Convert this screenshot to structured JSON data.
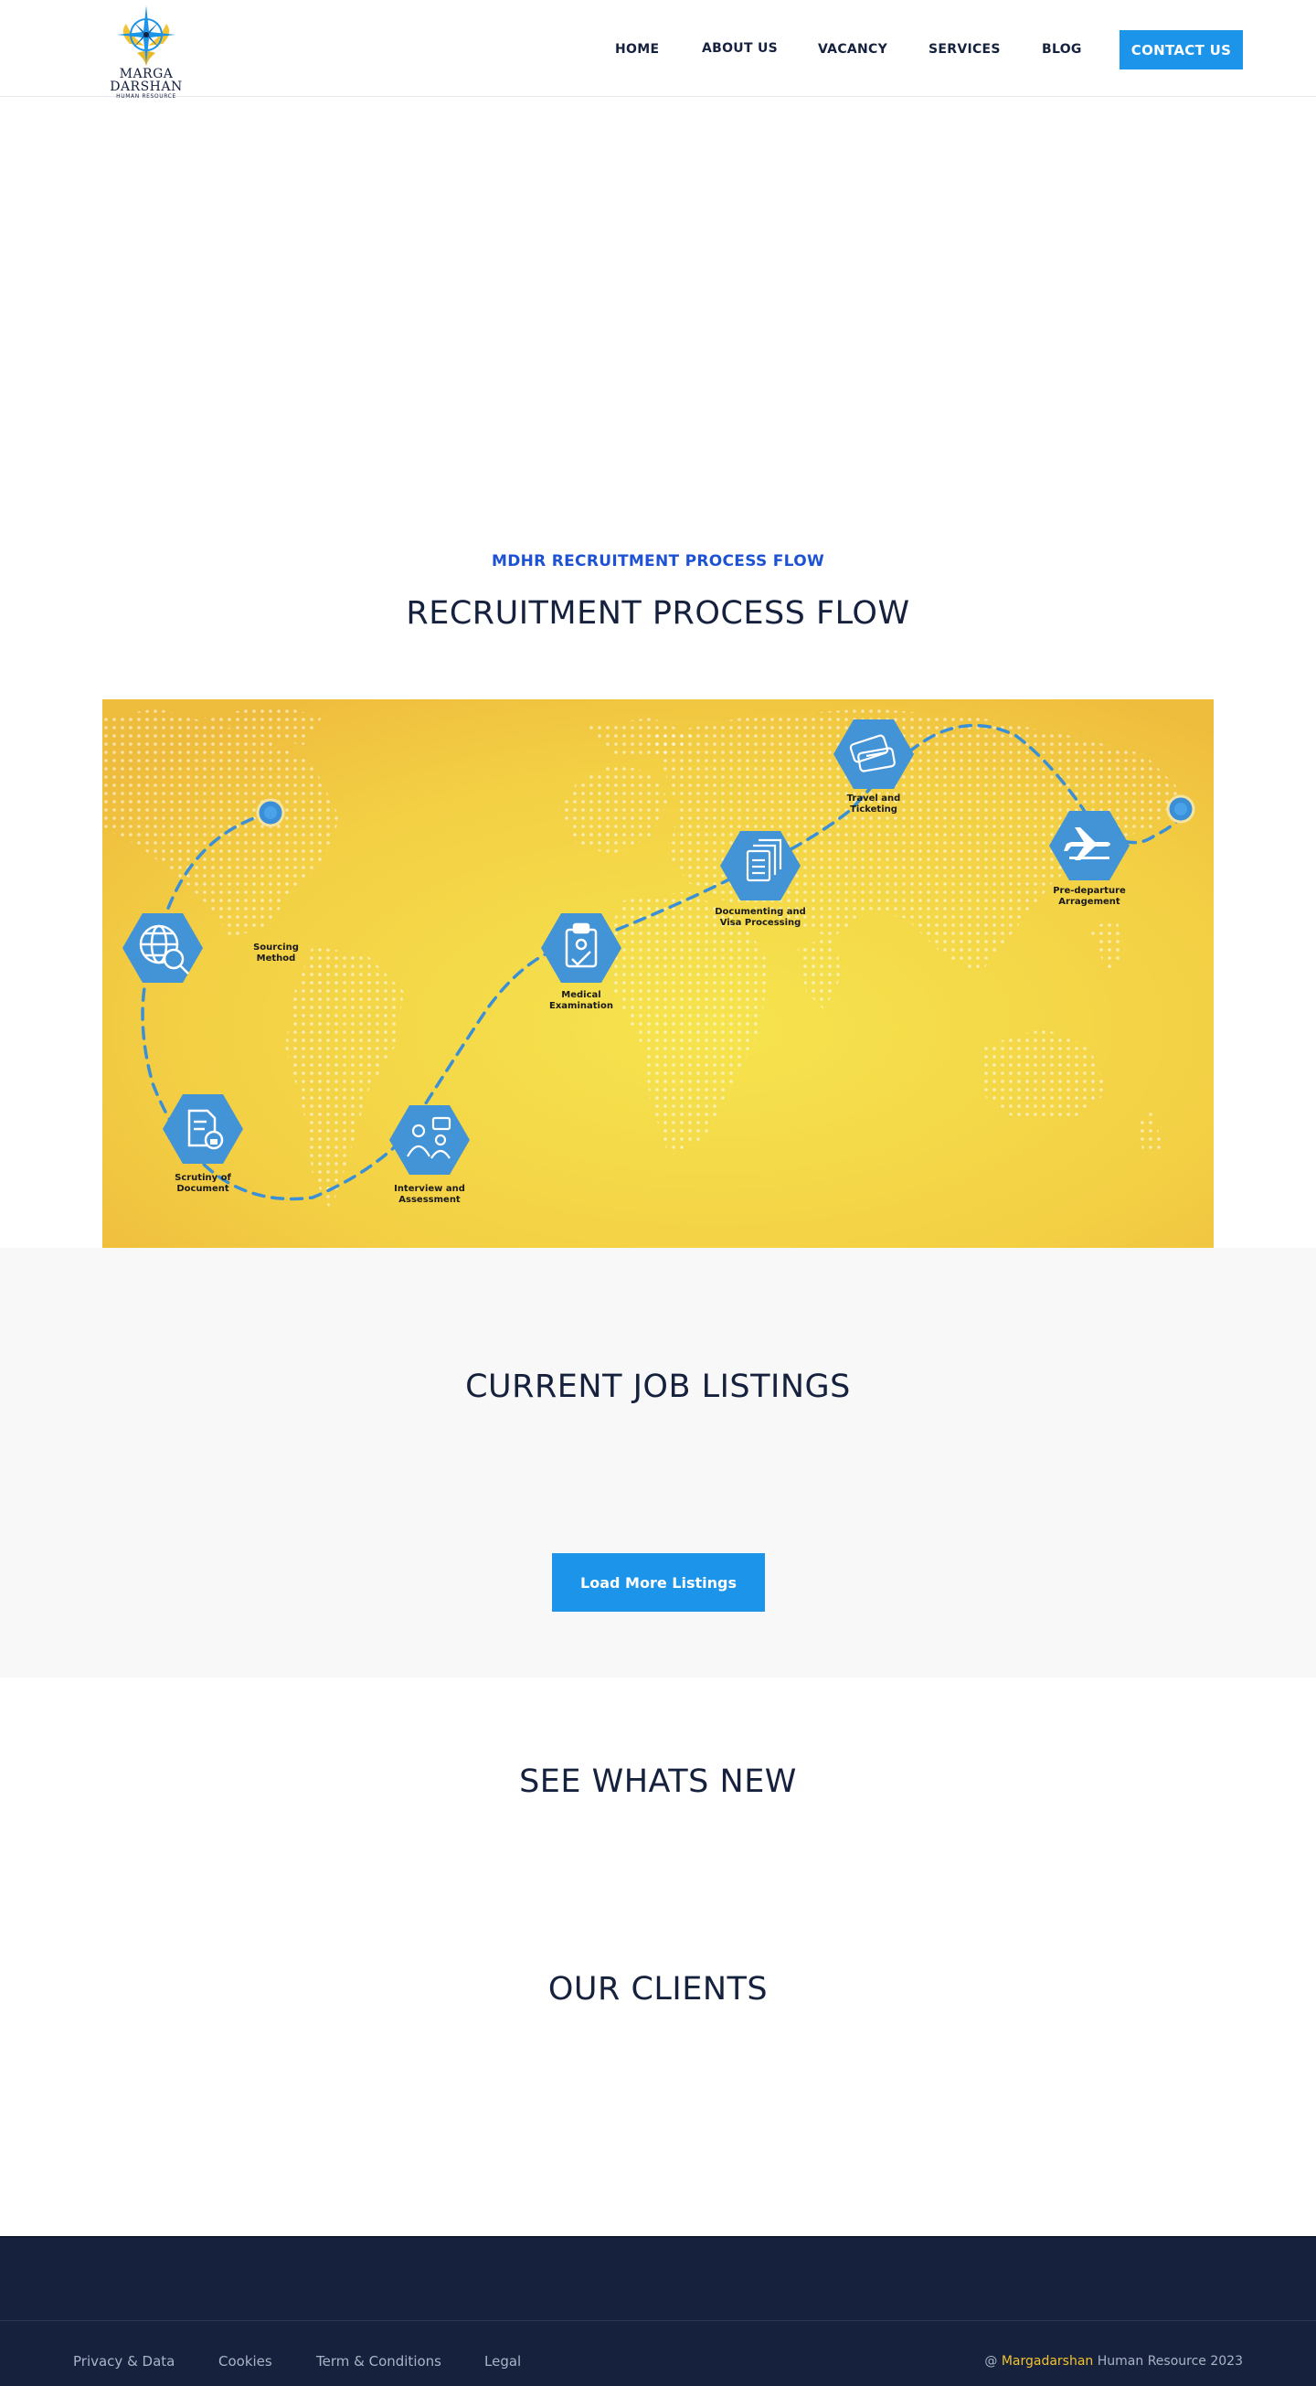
{
  "brand": {
    "name": "MARGA DARSHAN",
    "tagline": "HUMAN RESOURCE",
    "colors": {
      "primary": "#1b94ea",
      "navy": "#15213d",
      "accent": "#f2c230",
      "eyebrow": "#1e52d4"
    }
  },
  "nav": {
    "items": [
      {
        "label": "HOME"
      },
      {
        "label": "ABOUT US"
      },
      {
        "label": "VACANCY"
      },
      {
        "label": "SERVICES"
      },
      {
        "label": "BLOG"
      }
    ],
    "cta": "CONTACT US"
  },
  "process": {
    "eyebrow": "MDHR RECRUITMENT PROCESS FLOW",
    "title": "RECRUITMENT PROCESS FLOW",
    "steps": [
      {
        "line1": "Sourcing",
        "line2": "Method",
        "icon": "globe-search-icon"
      },
      {
        "line1": "Scrutiny of",
        "line2": "Document",
        "icon": "document-lock-icon"
      },
      {
        "line1": "Interview and",
        "line2": "Assessment",
        "icon": "interview-icon"
      },
      {
        "line1": "Medical",
        "line2": "Examination",
        "icon": "medical-clipboard-icon"
      },
      {
        "line1": "Documenting and",
        "line2": "Visa Processing",
        "icon": "documents-icon"
      },
      {
        "line1": "Travel and",
        "line2": "Ticketing",
        "icon": "tickets-icon"
      },
      {
        "line1": "Pre-departure",
        "line2": "Arragement",
        "icon": "airplane-icon"
      }
    ]
  },
  "jobs": {
    "title": "CURRENT JOB LISTINGS",
    "load_more": "Load More Listings"
  },
  "news": {
    "title": "SEE WHATS NEW"
  },
  "clients": {
    "title": "OUR CLIENTS"
  },
  "footer": {
    "links": [
      {
        "label": "Privacy & Data"
      },
      {
        "label": "Cookies"
      },
      {
        "label": "Term & Conditions"
      },
      {
        "label": "Legal"
      }
    ],
    "copyright_prefix": "@ ",
    "copyright_brand": "Margadarshan",
    "copyright_suffix": " Human Resource 2023"
  }
}
